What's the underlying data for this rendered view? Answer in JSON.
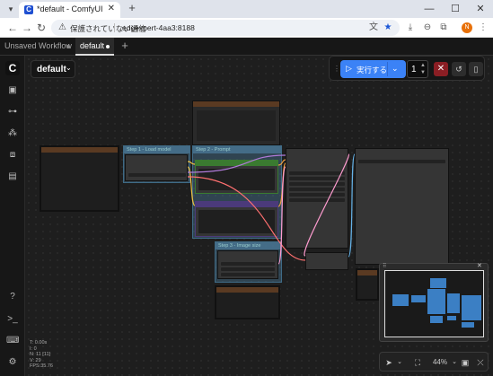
{
  "browser": {
    "tab_title": "*default - ComfyUI",
    "favicon_letter": "C",
    "not_secure_label": "保護されていない通信",
    "url": "edgexpert-4aa3:8188",
    "profile_initial": "N"
  },
  "app": {
    "workflow_tabs": [
      {
        "label": "Unsaved Workflow"
      },
      {
        "label": "default"
      }
    ],
    "workflow_selector": "default",
    "queue_button_label": "実行する",
    "batch_count": "1",
    "zoom_level": "44%"
  },
  "groups": [
    {
      "title": "Step 1 - Load model"
    },
    {
      "title": "Step 2 - Prompt"
    },
    {
      "title": "Step 3 - Image size"
    }
  ],
  "stats": [
    "T: 0.00s",
    "I: 0",
    "N: 11 [11]",
    "V: 29",
    "FPS:35.76"
  ],
  "colors": {
    "accent": "#3b82f6",
    "cancel": "#8b1e24",
    "group": "#487391"
  }
}
